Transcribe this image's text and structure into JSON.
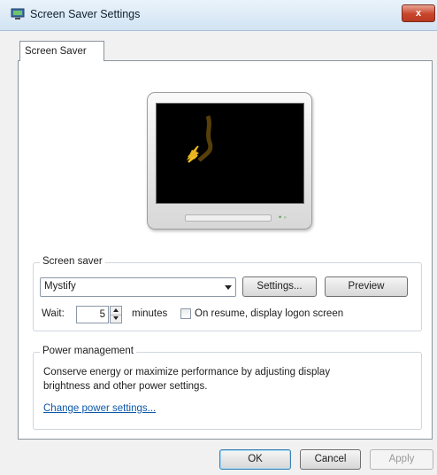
{
  "window": {
    "title": "Screen Saver Settings",
    "close_label": "x"
  },
  "tabs": [
    {
      "label": "Screen Saver"
    }
  ],
  "screen_saver": {
    "group_label": "Screen saver",
    "selected": "Mystify",
    "settings_label": "Settings...",
    "preview_label": "Preview",
    "wait_label": "Wait:",
    "wait_value": "5",
    "minutes_label": "minutes",
    "resume_label": "On resume, display logon screen",
    "resume_checked": false
  },
  "power": {
    "group_label": "Power management",
    "description_line1": "Conserve energy or maximize performance by adjusting display",
    "description_line2": "brightness and other power settings.",
    "link_label": "Change power settings..."
  },
  "footer": {
    "ok_label": "OK",
    "cancel_label": "Cancel",
    "apply_label": "Apply"
  }
}
